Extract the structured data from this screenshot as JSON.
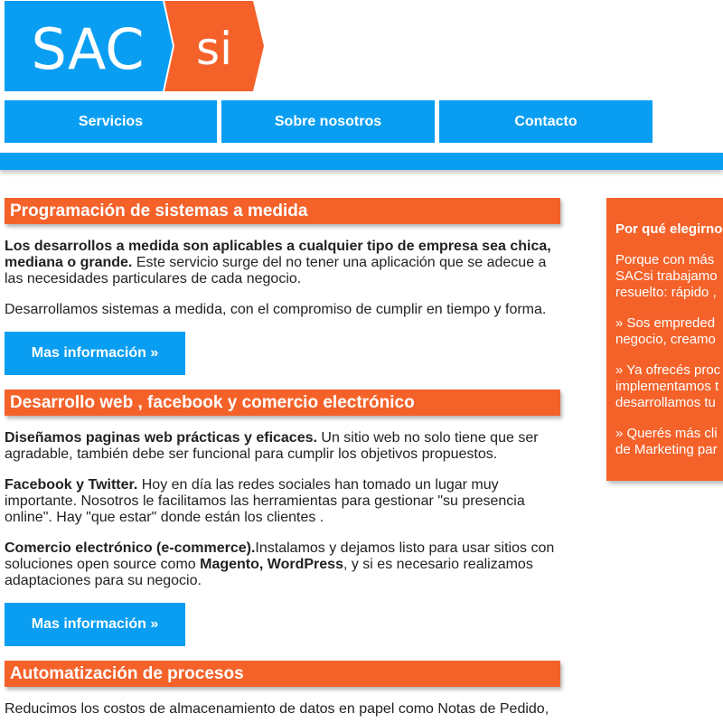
{
  "logo": {
    "text_left": "SAC",
    "text_right": "si",
    "colors": {
      "blue": "#099ef2",
      "orange": "#f4622a"
    }
  },
  "nav": {
    "items": [
      {
        "label": "Servicios"
      },
      {
        "label": "Sobre nosotros"
      },
      {
        "label": "Contacto"
      }
    ]
  },
  "sections": [
    {
      "title": "Programación de sistemas a medida",
      "p1_bold": "Los desarrollos a medida son aplicables a cualquier tipo de empresa sea chica, mediana o grande.",
      "p1_text": " Este servicio surge del no tener una aplicación que se adecue a las necesidades particulares de cada negocio.",
      "p2_text": "Desarrollamos sistemas a medida, con el compromiso de cumplir en tiempo y forma.",
      "button": "Mas información »"
    },
    {
      "title": "Desarrollo web , facebook y comercio electrónico",
      "p1_bold": "Diseñamos paginas web prácticas y eficaces.",
      "p1_text": " Un sitio web no solo tiene que ser agradable, también debe ser funcional para cumplir los objetivos propuestos.",
      "p2_bold": "Facebook y Twitter.",
      "p2_text": " Hoy en día las redes sociales han tomado un lugar muy importante. Nosotros le facilitamos las herramientas para gestionar \"su presencia online\". Hay \"que estar\" donde están los clientes .",
      "p3_bold": "Comercio electrónico (e-commerce).",
      "p3_text1": "Instalamos y dejamos listo para usar sitios con soluciones open source como ",
      "p3_bold2": "Magento, WordPress",
      "p3_text2": ", y si es necesario realizamos adaptaciones para su negocio.",
      "button": "Mas información »"
    },
    {
      "title": "Automatización de procesos",
      "p1_text": "Reducimos los costos de almacenamiento de datos en papel como Notas de Pedido,"
    }
  ],
  "sidebar": {
    "title": "Por qué elegirno",
    "p1_line1": "Porque con más",
    "p1_line2": "SACsi trabajamo",
    "p1_line3": "resuelto: rápido ,",
    "p2_line1": "» Sos empreded",
    "p2_line2": "negocio, creamo",
    "p3_line1": "» Ya ofrecés proc",
    "p3_line2": "implementamos t",
    "p3_line3": "desarrollamos tu",
    "p4_line1": "» Querés más cli",
    "p4_line2": "de Marketing par"
  }
}
